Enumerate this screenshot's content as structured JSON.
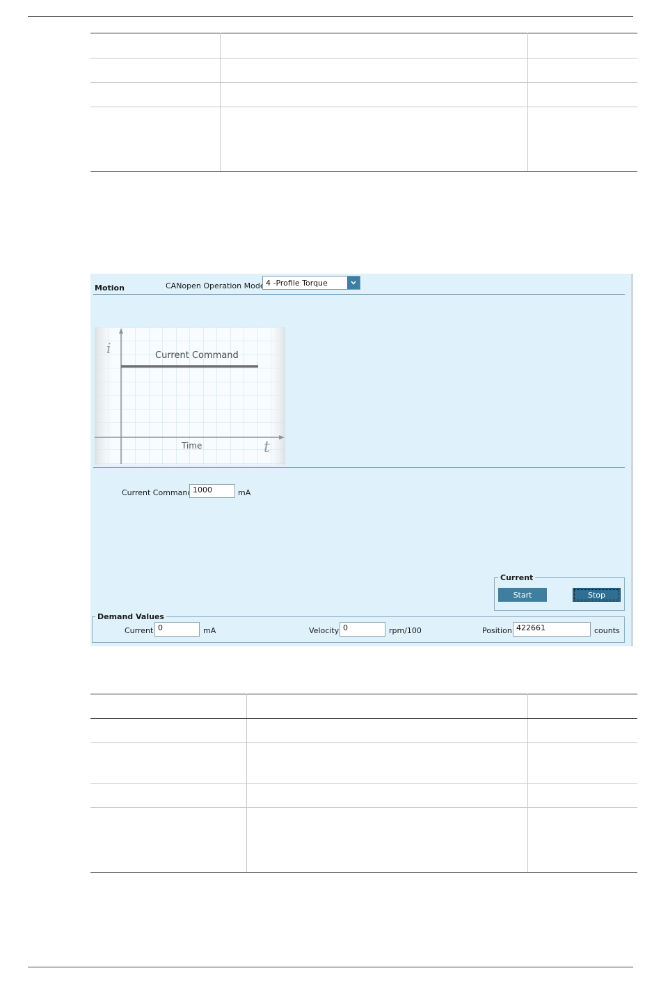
{
  "panel": {
    "title": "Motion",
    "mode_label": "CANopen Operation Mode",
    "mode_value": "4 -Profile Torque",
    "chart": {
      "y_symbol": "i",
      "x_symbol": "t",
      "line_label": "Current Command",
      "x_label": "Time"
    },
    "command": {
      "label": "Current Command",
      "value": "1000",
      "unit": "mA"
    },
    "current_group": {
      "title": "Current",
      "start_label": "Start",
      "stop_label": "Stop"
    },
    "demand": {
      "title": "Demand Values",
      "current_label": "Current",
      "current_value": "0",
      "current_unit": "mA",
      "velocity_label": "Velocity",
      "velocity_value": "0",
      "velocity_unit": "rpm/100",
      "position_label": "Position",
      "position_value": "422661",
      "position_unit": "counts"
    }
  },
  "colors": {
    "panel_bg": "#dff1fa",
    "button": "#3f7e9f",
    "accent": "#3b7ea6"
  }
}
